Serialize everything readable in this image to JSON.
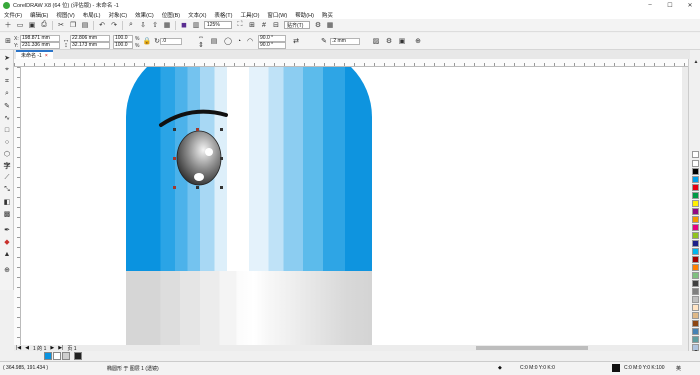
{
  "window": {
    "title": "CorelDRAW X8 (64 位) (评估版) - 未命名 -1",
    "controls": [
      "–",
      "☐",
      "✕"
    ]
  },
  "menu": {
    "items": [
      "文件(F)",
      "编辑(E)",
      "视图(V)",
      "布局(L)",
      "对象(C)",
      "效果(C)",
      "位图(B)",
      "文本(X)",
      "表格(T)",
      "工具(O)",
      "窗口(W)",
      "帮助(H)",
      "购买"
    ]
  },
  "toolbar": {
    "zoom_value": "125%",
    "snap_label": "贴齐(T)"
  },
  "property_bar": {
    "x_label": "X:",
    "x_value": "198.871 mm",
    "y_label": "Y:",
    "y_value": "231.336 mm",
    "w_value": "22.806 mm",
    "h_value": "32.173 mm",
    "scale_w": "100.0",
    "scale_h": "100.0",
    "scale_unit": "%",
    "rotation": ".0",
    "angle_start": "90.0 °",
    "angle_end": "90.0 °",
    "outline": ".2 mm"
  },
  "document": {
    "tab_label": "未命名 -1"
  },
  "page_nav": {
    "page_label": "页 1",
    "page_count": "1 的 1"
  },
  "status": {
    "coords": "( 364.985, 191.434 )",
    "object_info": "椭圆形 于 图层 1 (透镜)",
    "fill_info": "C:0 M:0 Y:0 K:0",
    "outline_info": "C:0 M:0 Y:0 K:100",
    "ime": "英"
  },
  "colors": {
    "accent": "#2b74c8",
    "capsule_blue": "#0a93e0",
    "eyebrow": "#111111"
  },
  "palette": [
    "#ffffff",
    "#000000",
    "#00a0e9",
    "#e60012",
    "#009944",
    "#fff100",
    "#920783",
    "#f39800",
    "#e4007f",
    "#8fc31f",
    "#1d2088",
    "#00b7ee",
    "#a40000",
    "#ff7f00",
    "#7fbf7f",
    "#3f3f3f",
    "#7f7f7f",
    "#bfbfbf",
    "#ffe4c4",
    "#deb887",
    "#8b4513",
    "#4682b4",
    "#5f9ea0",
    "#b0c4de"
  ]
}
